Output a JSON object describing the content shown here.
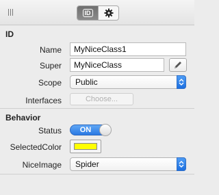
{
  "toolbar": {
    "tabs": [
      {
        "label": "ID",
        "active": true
      },
      {
        "icon": "gear-icon",
        "active": false
      }
    ]
  },
  "id_section": {
    "title": "ID",
    "name": {
      "label": "Name",
      "value": "MyNiceClass1"
    },
    "super": {
      "label": "Super",
      "value": "MyNiceClass"
    },
    "scope": {
      "label": "Scope",
      "value": "Public"
    },
    "interfaces": {
      "label": "Interfaces",
      "button": "Choose..."
    }
  },
  "behavior_section": {
    "title": "Behavior",
    "status": {
      "label": "Status",
      "value": "ON"
    },
    "selected_color": {
      "label": "SelectedColor",
      "color": "#ffff00"
    },
    "nice_image": {
      "label": "NiceImage",
      "value": "Spider"
    }
  },
  "colors": {
    "accent": "#2a79e3",
    "background": "#ececec"
  }
}
